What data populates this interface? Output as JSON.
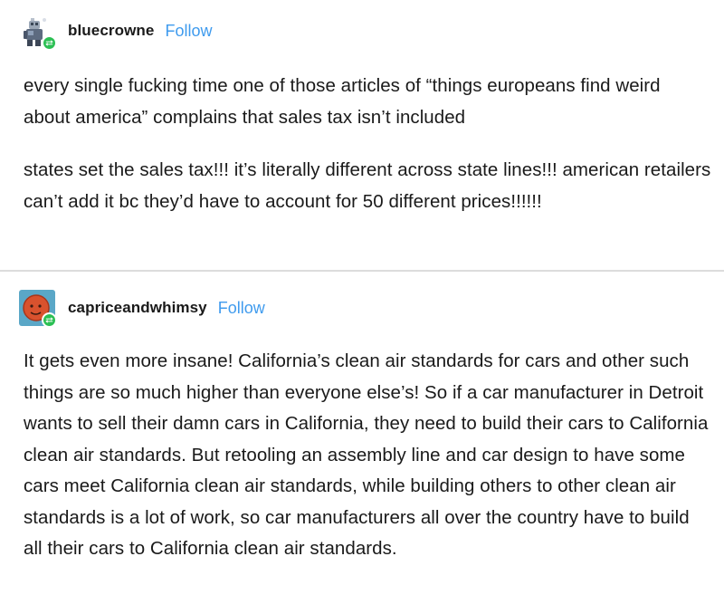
{
  "posts": [
    {
      "username": "bluecrowne",
      "follow_label": "Follow",
      "avatar_icon": "robot-avatar-icon",
      "paragraphs": [
        "every single fucking time one of those articles of “things europeans find weird about america” complains that sales tax isn’t included",
        "states set the sales tax!!! it’s literally different across state lines!!! american retailers can’t add it bc they’d have to account for 50 different prices!!!!!!"
      ]
    },
    {
      "username": "capriceandwhimsy",
      "follow_label": "Follow",
      "avatar_icon": "red-face-avatar-icon",
      "paragraphs": [
        "It gets even more insane! California’s clean air standards for cars and other such things are so much higher than everyone else’s! So if a car manufacturer in Detroit wants to sell their damn cars in California, they need to build their cars to California clean air standards. But retooling an assembly line and car design to have some cars meet California clean air standards, while building others to other clean air standards is a lot of work, so car manufacturers all over the country have to build all their cars to California clean air standards."
      ]
    }
  ],
  "colors": {
    "follow": "#3f9bee",
    "reblog_badge": "#2bbf53",
    "text": "#1a1a1a",
    "divider": "#dcdcdc"
  },
  "icons": {
    "reblog": "reblog-icon"
  }
}
